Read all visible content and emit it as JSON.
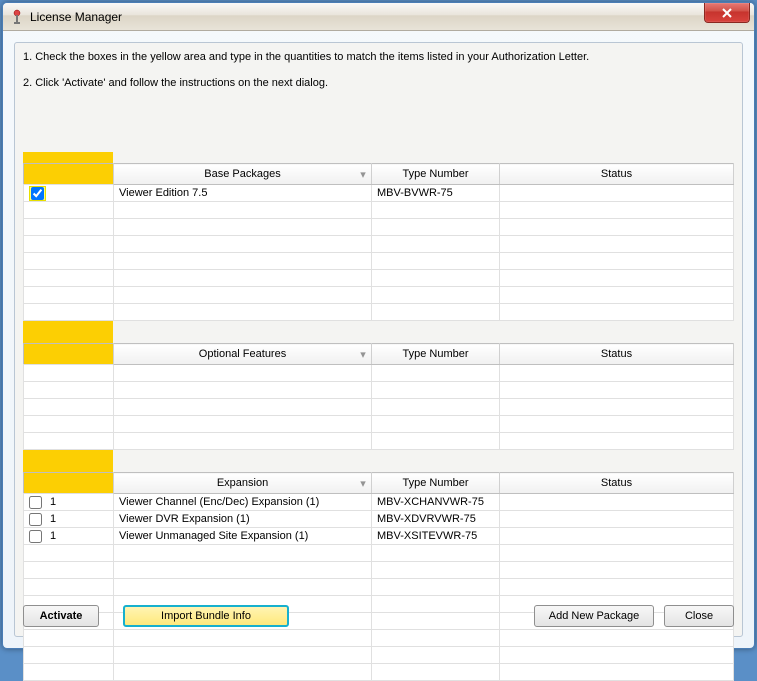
{
  "window": {
    "title": "License Manager"
  },
  "instructions": {
    "line1": "1. Check the boxes in the yellow area and type in the quantities to match the items listed in your Authorization Letter.",
    "line2": "2. Click 'Activate' and follow the instructions on the next dialog."
  },
  "columns": {
    "type_number": "Type Number",
    "status": "Status"
  },
  "tables": {
    "base": {
      "header": "Base Packages",
      "rows": [
        {
          "checked": true,
          "qty": "",
          "name": "Viewer Edition 7.5",
          "type": "MBV-BVWR-75",
          "status": ""
        }
      ],
      "blank_rows": 7
    },
    "optional": {
      "header": "Optional Features",
      "rows": [],
      "blank_rows": 5
    },
    "expansion": {
      "header": "Expansion",
      "rows": [
        {
          "checked": false,
          "qty": "1",
          "name": "Viewer Channel (Enc/Dec) Expansion (1)",
          "type": "MBV-XCHANVWR-75",
          "status": ""
        },
        {
          "checked": false,
          "qty": "1",
          "name": "Viewer DVR Expansion (1)",
          "type": "MBV-XDVRVWR-75",
          "status": ""
        },
        {
          "checked": false,
          "qty": "1",
          "name": "Viewer Unmanaged Site Expansion (1)",
          "type": "MBV-XSITEVWR-75",
          "status": ""
        }
      ],
      "blank_rows": 8
    }
  },
  "buttons": {
    "activate": "Activate",
    "import_bundle": "Import Bundle Info",
    "add_new_package": "Add New Package",
    "close": "Close"
  }
}
